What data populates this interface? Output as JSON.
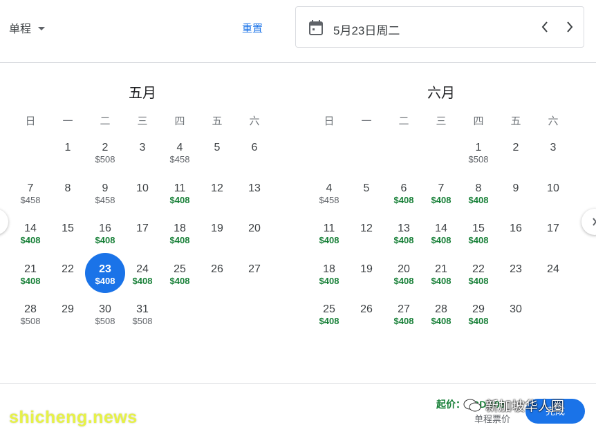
{
  "header": {
    "trip_type": "单程",
    "reset_label": "重置",
    "selected_date": "5月23日周二"
  },
  "weekdays": [
    "日",
    "一",
    "二",
    "三",
    "四",
    "五",
    "六"
  ],
  "months": [
    {
      "title": "五月",
      "first_weekday": 1,
      "days": [
        {
          "d": "1",
          "p": ""
        },
        {
          "d": "2",
          "p": "$508",
          "low": false
        },
        {
          "d": "3",
          "p": ""
        },
        {
          "d": "4",
          "p": "$458",
          "low": false
        },
        {
          "d": "5",
          "p": ""
        },
        {
          "d": "6",
          "p": ""
        },
        {
          "d": "7",
          "p": "$458",
          "low": false
        },
        {
          "d": "8",
          "p": ""
        },
        {
          "d": "9",
          "p": "$458",
          "low": false
        },
        {
          "d": "10",
          "p": ""
        },
        {
          "d": "11",
          "p": "$408",
          "low": true
        },
        {
          "d": "12",
          "p": ""
        },
        {
          "d": "13",
          "p": ""
        },
        {
          "d": "14",
          "p": "$408",
          "low": true
        },
        {
          "d": "15",
          "p": ""
        },
        {
          "d": "16",
          "p": "$408",
          "low": true
        },
        {
          "d": "17",
          "p": ""
        },
        {
          "d": "18",
          "p": "$408",
          "low": true
        },
        {
          "d": "19",
          "p": ""
        },
        {
          "d": "20",
          "p": ""
        },
        {
          "d": "21",
          "p": "$408",
          "low": true
        },
        {
          "d": "22",
          "p": ""
        },
        {
          "d": "23",
          "p": "$408",
          "low": true,
          "selected": true
        },
        {
          "d": "24",
          "p": "$408",
          "low": true
        },
        {
          "d": "25",
          "p": "$408",
          "low": true
        },
        {
          "d": "26",
          "p": ""
        },
        {
          "d": "27",
          "p": ""
        },
        {
          "d": "28",
          "p": "$508",
          "low": false
        },
        {
          "d": "29",
          "p": ""
        },
        {
          "d": "30",
          "p": "$508",
          "low": false
        },
        {
          "d": "31",
          "p": "$508",
          "low": false
        }
      ]
    },
    {
      "title": "六月",
      "first_weekday": 4,
      "days": [
        {
          "d": "1",
          "p": "$508",
          "low": false
        },
        {
          "d": "2",
          "p": ""
        },
        {
          "d": "3",
          "p": ""
        },
        {
          "d": "4",
          "p": "$458",
          "low": false
        },
        {
          "d": "5",
          "p": ""
        },
        {
          "d": "6",
          "p": "$408",
          "low": true
        },
        {
          "d": "7",
          "p": "$408",
          "low": true
        },
        {
          "d": "8",
          "p": "$408",
          "low": true
        },
        {
          "d": "9",
          "p": ""
        },
        {
          "d": "10",
          "p": ""
        },
        {
          "d": "11",
          "p": "$408",
          "low": true
        },
        {
          "d": "12",
          "p": ""
        },
        {
          "d": "13",
          "p": "$408",
          "low": true
        },
        {
          "d": "14",
          "p": "$408",
          "low": true
        },
        {
          "d": "15",
          "p": "$408",
          "low": true
        },
        {
          "d": "16",
          "p": ""
        },
        {
          "d": "17",
          "p": ""
        },
        {
          "d": "18",
          "p": "$408",
          "low": true
        },
        {
          "d": "19",
          "p": ""
        },
        {
          "d": "20",
          "p": "$408",
          "low": true
        },
        {
          "d": "21",
          "p": "$408",
          "low": true
        },
        {
          "d": "22",
          "p": "$408",
          "low": true
        },
        {
          "d": "23",
          "p": ""
        },
        {
          "d": "24",
          "p": ""
        },
        {
          "d": "25",
          "p": "$408",
          "low": true
        },
        {
          "d": "26",
          "p": ""
        },
        {
          "d": "27",
          "p": "$408",
          "low": true
        },
        {
          "d": "28",
          "p": "$408",
          "low": true
        },
        {
          "d": "29",
          "p": "$408",
          "low": true
        },
        {
          "d": "30",
          "p": ""
        }
      ]
    }
  ],
  "footer": {
    "from_price": "起价：SGD 408",
    "fare_type": "单程票价",
    "done_label": "完成"
  },
  "watermarks": {
    "source": "shicheng.news",
    "group": "新加坡华人圈"
  },
  "colors": {
    "accent": "#1a73e8",
    "low_price": "#188038",
    "price": "#5f6368",
    "watermark_source": "#e7f246"
  },
  "icons": {
    "calendar": "calendar-icon",
    "prev": "chevron-left-icon",
    "next": "chevron-right-icon",
    "dropdown": "caret-down-icon",
    "wechat": "wechat-icon"
  }
}
